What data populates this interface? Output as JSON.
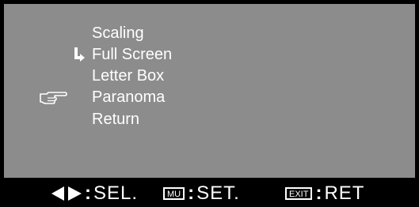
{
  "menu": {
    "items": [
      {
        "label": "Scaling"
      },
      {
        "label": "Full Screen"
      },
      {
        "label": "Letter Box"
      },
      {
        "label": "Paranoma"
      },
      {
        "label": "Return"
      }
    ],
    "current_marker_icon": "return-arrow-icon",
    "cursor_icon": "pointing-hand-icon"
  },
  "status_bar": {
    "select_label": "SEL.",
    "select_icon": "left-right-arrows-icon",
    "set_key": "MU",
    "set_label": "SET.",
    "return_key": "EXIT",
    "return_label": "RET",
    "colon": ":"
  },
  "colors": {
    "panel": "#8c8c8c",
    "background": "#000000",
    "text": "#ffffff"
  }
}
